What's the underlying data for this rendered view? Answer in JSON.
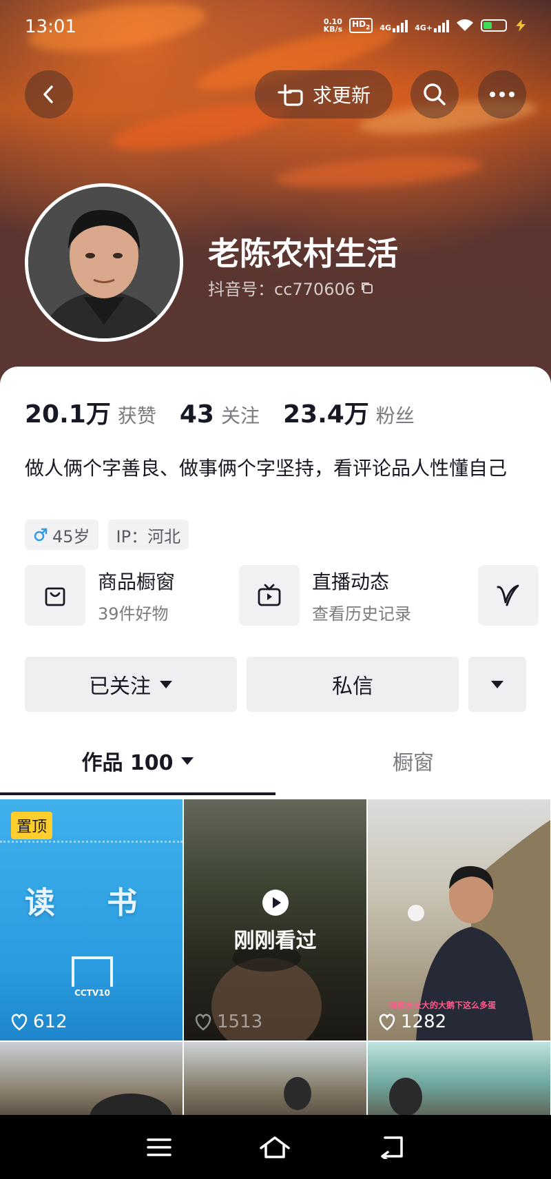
{
  "status_bar": {
    "time": "13:01",
    "net_speed_value": "0.10",
    "net_speed_unit": "KB/s",
    "hd": "HD",
    "hd_sub": "2",
    "sig1": "4G",
    "sig2": "4G+"
  },
  "top_bar": {
    "request_update_label": "求更新"
  },
  "profile": {
    "nickname": "老陈农村生活",
    "douyin_id": "抖音号：cc770606"
  },
  "stats": [
    {
      "value": "20.1万",
      "label": "获赞"
    },
    {
      "value": "43",
      "label": "关注"
    },
    {
      "value": "23.4万",
      "label": "粉丝"
    }
  ],
  "bio": "做人俩个字善良、做事俩个字坚持，看评论品人性懂自己",
  "tags": {
    "gender_age": "45岁",
    "ip": "IP：河北"
  },
  "features": [
    {
      "title": "商品橱窗",
      "subtitle": "39件好物",
      "icon": "shopping-bag-icon"
    },
    {
      "title": "直播动态",
      "subtitle": "查看历史记录",
      "icon": "tv-icon"
    }
  ],
  "actions": {
    "follow_label": "已关注",
    "message_label": "私信"
  },
  "tabs": {
    "works_label": "作品 100",
    "showcase_label": "橱窗"
  },
  "videos": [
    {
      "likes": "612",
      "pinned_label": "置顶",
      "overlay_text": "读 书",
      "logo_text": "CCTV10"
    },
    {
      "likes": "1513",
      "overlay_text": "刚刚看过"
    },
    {
      "likes": "1282",
      "caption": "喝泉水长大的大鹅下这么多蛋"
    },
    {
      "likes": ""
    },
    {
      "likes": ""
    },
    {
      "likes": ""
    }
  ],
  "colors": {
    "like_yellow": "#fece2e",
    "male_blue": "#2f9be6",
    "battery_green": "#3ddc5a"
  }
}
